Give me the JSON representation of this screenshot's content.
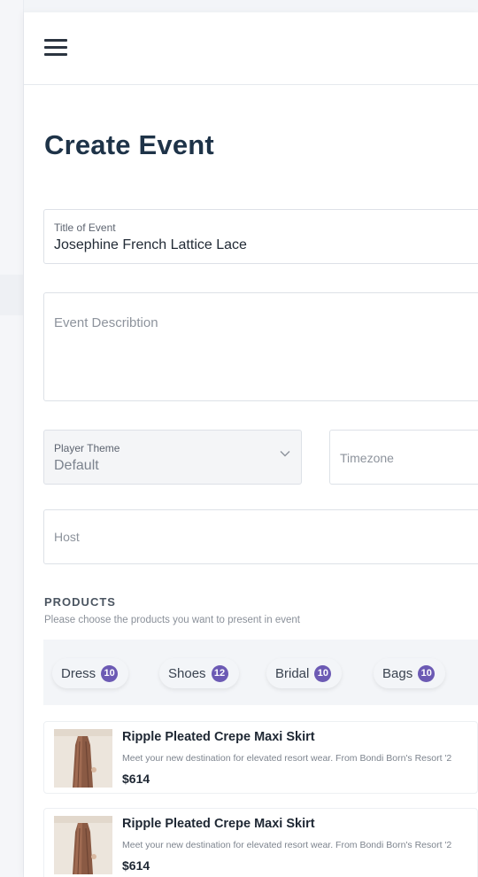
{
  "page": {
    "title": "Create Event"
  },
  "form": {
    "title_field": {
      "label": "Title of Event",
      "value": "Josephine French Lattice Lace"
    },
    "description_field": {
      "placeholder": "Event Describtion"
    },
    "player_theme": {
      "label": "Player Theme",
      "value": "Default"
    },
    "timezone": {
      "placeholder": "Timezone"
    },
    "host": {
      "placeholder": "Host"
    }
  },
  "products": {
    "heading": "PRODUCTS",
    "subtitle": "Please choose the products you want to present in event",
    "categories": [
      {
        "label": "Dress",
        "count": "10"
      },
      {
        "label": "Shoes",
        "count": "12"
      },
      {
        "label": "Bridal",
        "count": "10"
      },
      {
        "label": "Bags",
        "count": "10"
      }
    ],
    "items": [
      {
        "name": "Ripple Pleated Crepe Maxi Skirt",
        "description": "Meet your new destination for elevated resort wear. From Bondi Born's Resort '2",
        "price": "$614"
      },
      {
        "name": "Ripple Pleated Crepe Maxi Skirt",
        "description": "Meet your new destination for elevated resort wear. From Bondi Born's Resort '2",
        "price": "$614"
      }
    ]
  },
  "colors": {
    "accent": "#6c5ab4",
    "title": "#1e3348"
  },
  "icons": {
    "menu": "hamburger-menu-icon",
    "select": "chevron-down-icon"
  }
}
